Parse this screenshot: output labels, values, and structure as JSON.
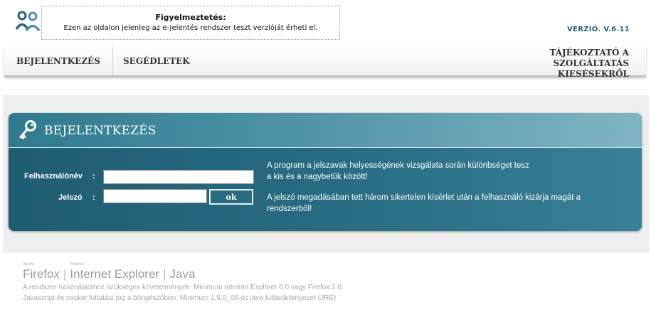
{
  "header": {
    "warning_title": "Figyelmeztetés:",
    "warning_text": "Ezen az oldalon jelenleg az e-Jelentés rendszer teszt verzióját érheti el.",
    "version": "VERZIÓ. V.6.11",
    "logo_icon": "users-icon"
  },
  "nav": {
    "login": "BEJELENTKEZÉS",
    "help": "SEGÉDLETEK",
    "info_lines": [
      "TÁJÉKOZTATÓ A",
      "SZOLGÁLTATÁS",
      "KIESÉSEKRŐL"
    ]
  },
  "panel": {
    "title": "BEJELENTKEZÉS",
    "icon": "key-icon",
    "username_label": "Felhasználónév",
    "password_label": "Jelszó",
    "colon": ":",
    "username_value": "",
    "password_value": "",
    "ok_label": "ok",
    "note1_lines": [
      "A program a jelszavak helyességének vizsgálata során különbséget tesz",
      "a kis és a nagybetűk között!"
    ],
    "note2_lines": [
      "A jelszó megadásában tett három sikertelen kísérlet után a felhasználó kizárja magát a",
      "rendszerből!"
    ]
  },
  "footer": {
    "firefox_small": "Mozilla",
    "firefox": "Firefox",
    "ie_small": "Windows",
    "ie": "Internet Explorer",
    "java": "Java",
    "separator": "|",
    "text_lines": [
      "A rendszer használatához szükséges követelmények: Minimum Internet Explorer 6.0 vagy Firefox 2.0.",
      "Javascript és cookie futtatási jog a böngészőben. Minimum 1.6.0_06-os java futtatókörnyezet (JRE)"
    ]
  },
  "colors": {
    "accent": "#2a6b80",
    "version_text": "#2a6079"
  }
}
